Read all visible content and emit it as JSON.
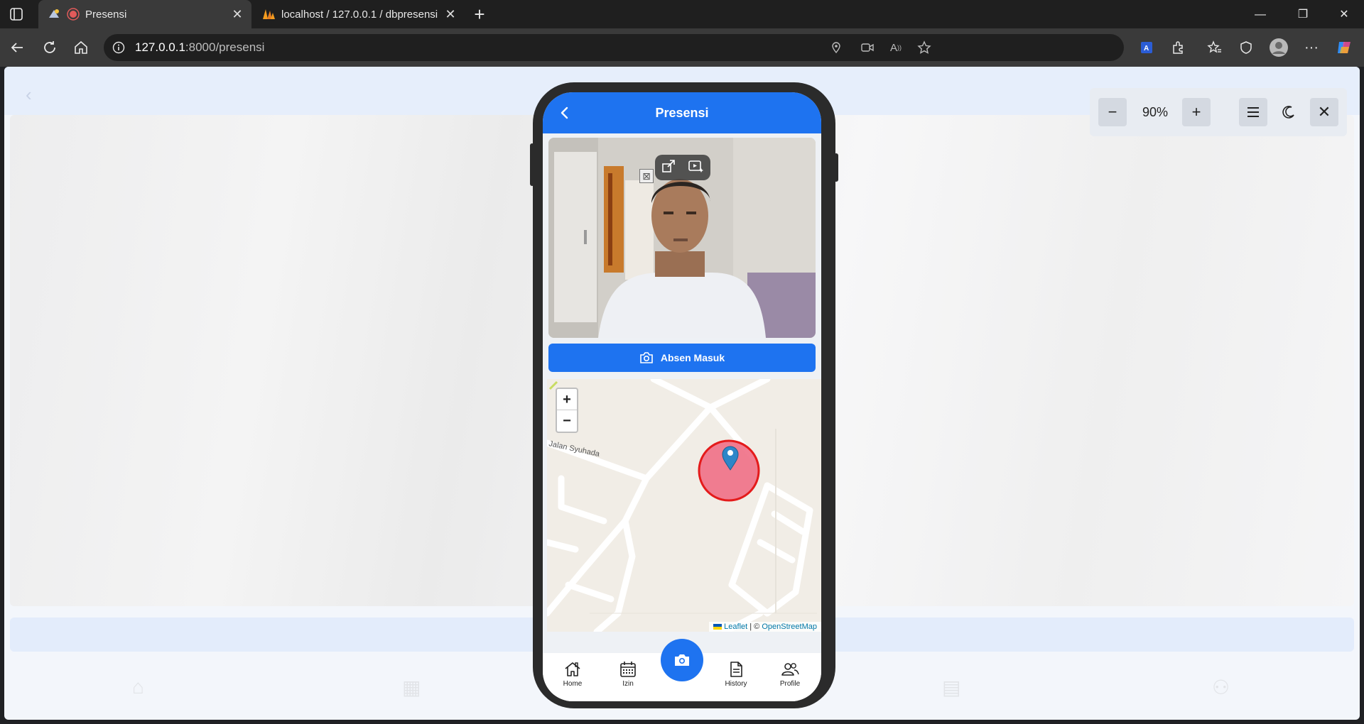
{
  "browser": {
    "tabs": [
      {
        "title": "Presensi",
        "active": true
      },
      {
        "title": "localhost / 127.0.0.1 / dbpresensi"
      }
    ],
    "url_host": "127.0.0.1",
    "url_rest": ":8000/presensi",
    "window_controls": [
      "minimize",
      "restore",
      "close"
    ]
  },
  "emulator": {
    "zoom": "90%"
  },
  "app": {
    "title": "Presensi",
    "absen_label": "Absen Masuk",
    "map": {
      "street_label": "Jalan Syuhada",
      "zoom_in": "+",
      "zoom_out": "−",
      "attribution_leaflet": "Leaflet",
      "attribution_sep": " | © ",
      "attribution_osm": "OpenStreetMap"
    },
    "nav": [
      {
        "label": "Home",
        "icon": "home-icon"
      },
      {
        "label": "Izin",
        "icon": "calendar-icon"
      },
      {
        "label": "",
        "icon": "camera-icon"
      },
      {
        "label": "History",
        "icon": "document-icon"
      },
      {
        "label": "Profile",
        "icon": "users-icon"
      }
    ]
  },
  "colors": {
    "primary": "#1e73f0",
    "radius_fill": "#f06f86",
    "radius_stroke": "#e41b1b"
  }
}
